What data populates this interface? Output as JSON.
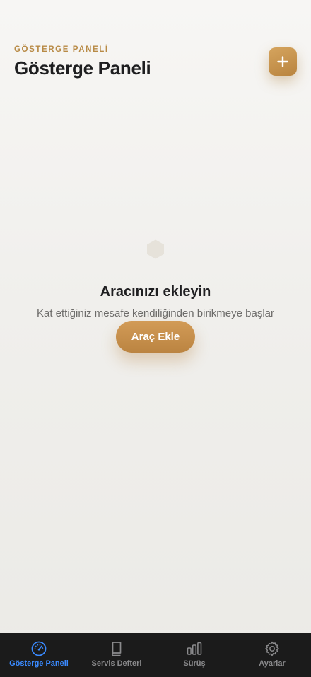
{
  "header": {
    "eyebrow": "GÖSTERGE PANELİ",
    "title": "Gösterge Paneli",
    "add_label": "+"
  },
  "empty_state": {
    "icon": "hexagon-icon",
    "title": "Aracınızı ekleyin",
    "subtitle": "Kat ettiğiniz mesafe kendiliğinden birikmeye başlar",
    "button_label": "Araç Ekle"
  },
  "tabbar": {
    "items": [
      {
        "label": "Gösterge Paneli",
        "icon": "speedometer-icon",
        "active": true
      },
      {
        "label": "Servis Defteri",
        "icon": "book-icon",
        "active": false
      },
      {
        "label": "Sürüş",
        "icon": "bar-chart-icon",
        "active": false
      },
      {
        "label": "Ayarlar",
        "icon": "gear-icon",
        "active": false
      }
    ]
  },
  "colors": {
    "accent": "#c8954f",
    "active_tab": "#3a8aff",
    "tabbar_bg": "#1b1b1b"
  }
}
